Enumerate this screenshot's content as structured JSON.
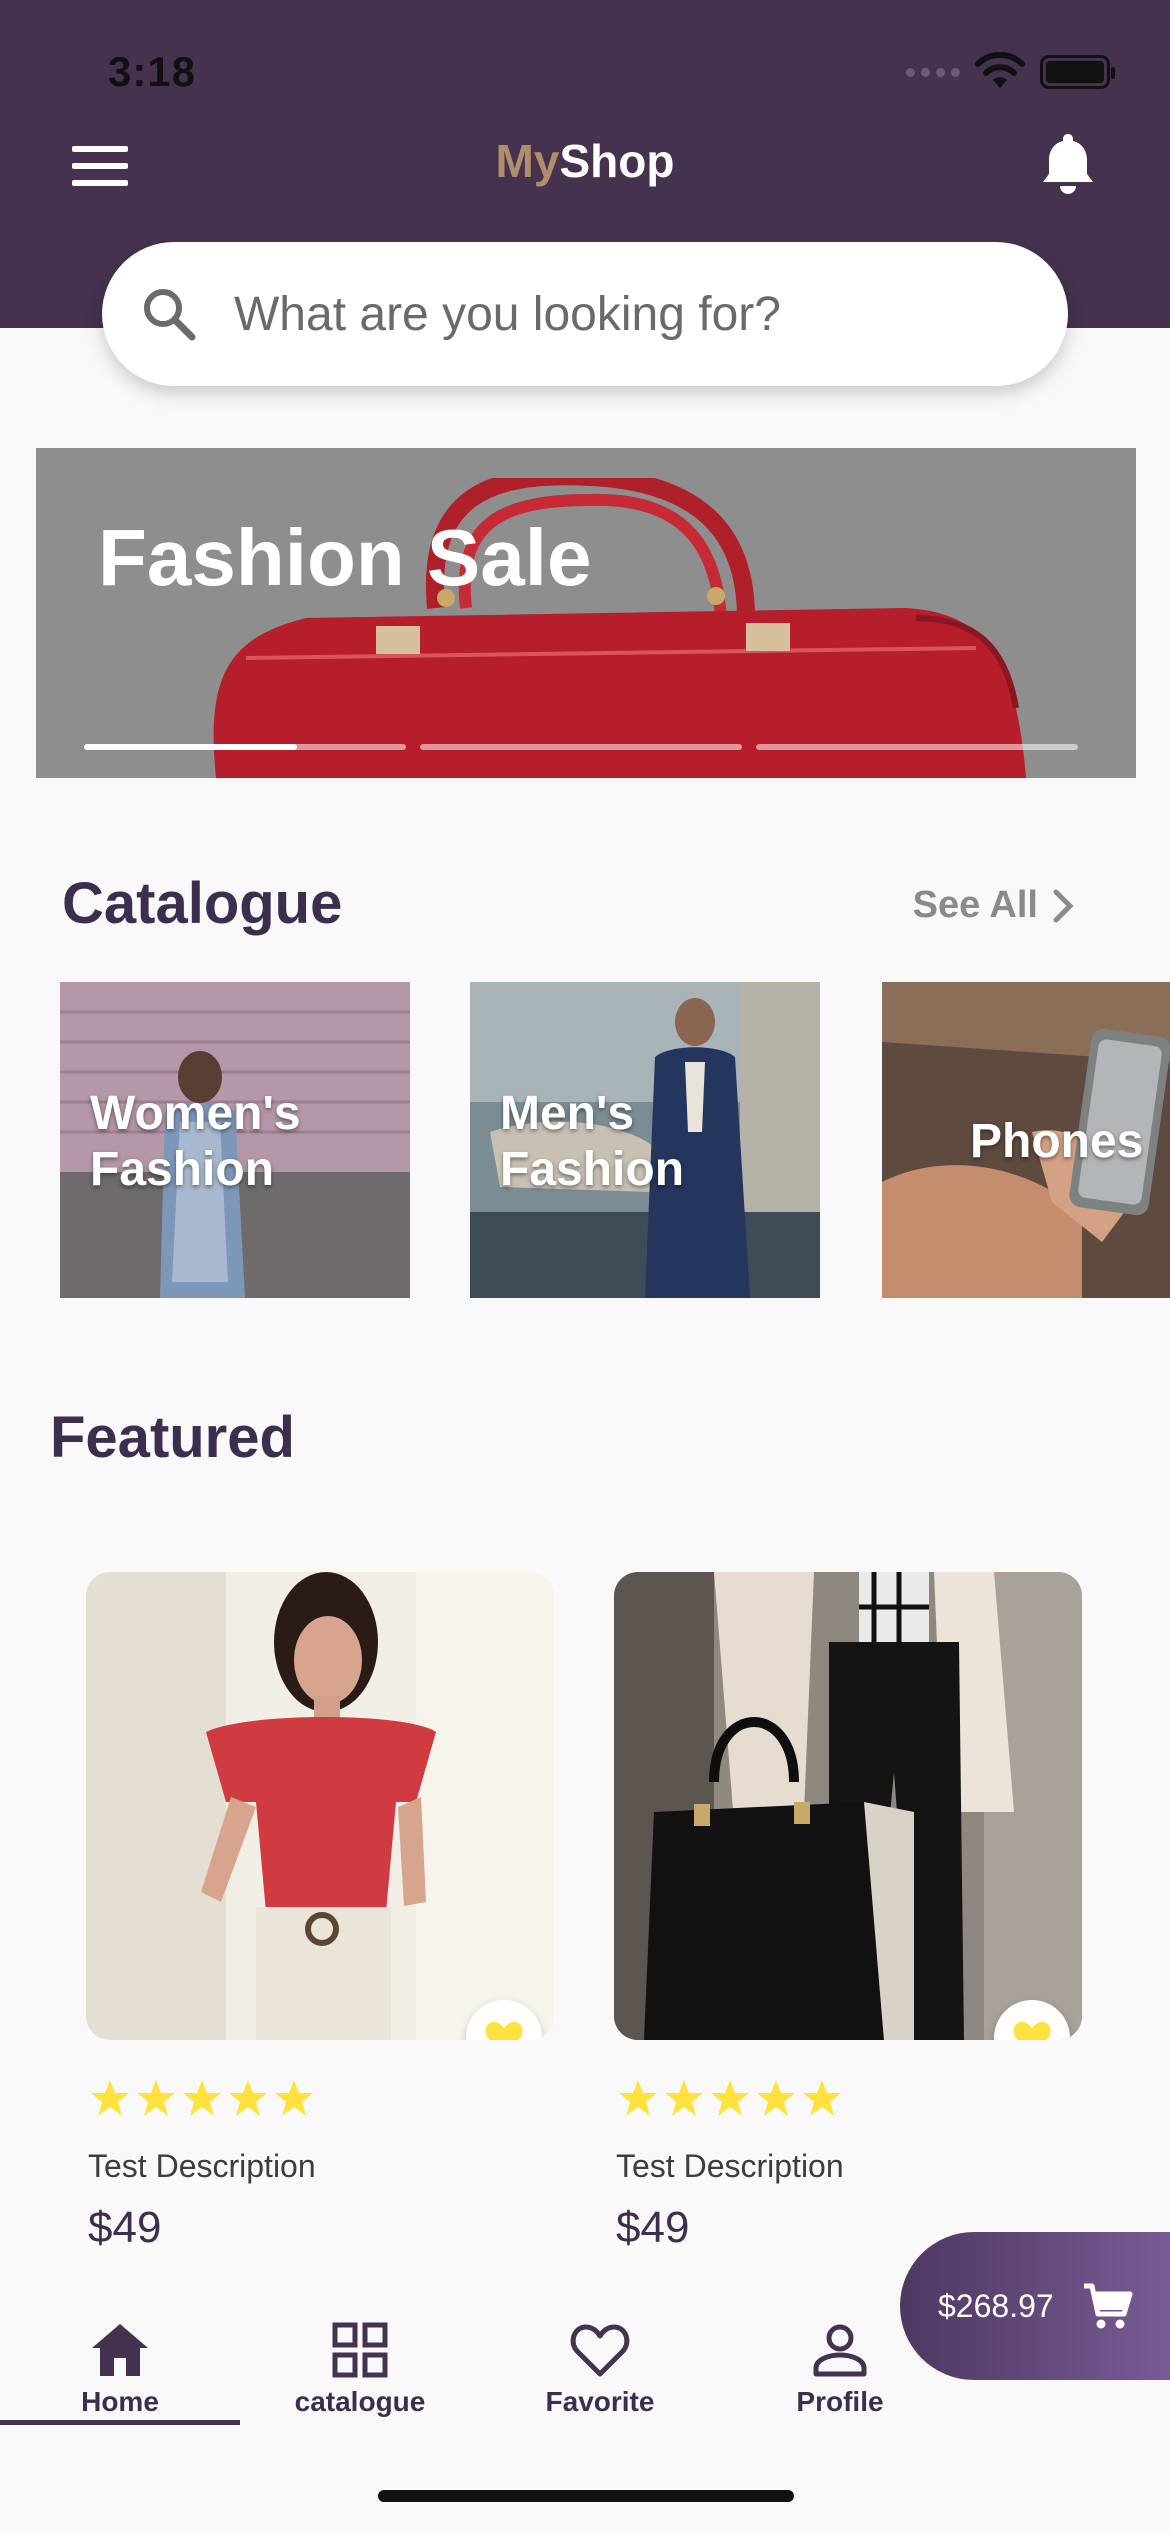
{
  "status_bar": {
    "time": "3:18"
  },
  "header": {
    "brand_part1": "My",
    "brand_part2": "Shop",
    "brand_colors": {
      "my": "#b08d6b",
      "shop": "#ffffff"
    },
    "background": "#44324f",
    "menu_icon": "hamburger-menu-icon",
    "notification_icon": "bell-icon"
  },
  "search": {
    "placeholder": "What are you looking for?",
    "value": ""
  },
  "banner": {
    "title": "Fashion Sale",
    "slides_count": 3,
    "active_slide": 1,
    "active_progress": 0.66
  },
  "catalogue": {
    "title": "Catalogue",
    "see_all": "See All",
    "items": [
      {
        "line1": "Women's",
        "line2": "Fashion"
      },
      {
        "line1": "Men's",
        "line2": "Fashion"
      },
      {
        "line1": "Phones",
        "line2": ""
      }
    ]
  },
  "featured": {
    "title": "Featured",
    "products": [
      {
        "description": "Test Description",
        "price": "$49",
        "rating": 5,
        "favorite": true
      },
      {
        "description": "Test Description",
        "price": "$49",
        "rating": 5,
        "favorite": true
      }
    ]
  },
  "cart": {
    "total": "$268.97",
    "icon": "shopping-cart-icon"
  },
  "tabs": [
    {
      "label": "Home",
      "icon": "home-icon",
      "active": true
    },
    {
      "label": "catalogue",
      "icon": "grid-icon",
      "active": false
    },
    {
      "label": "Favorite",
      "icon": "heart-icon",
      "active": false
    },
    {
      "label": "Profile",
      "icon": "person-icon",
      "active": false
    }
  ],
  "colors": {
    "accent": "#44324f",
    "star": "#ffe23d",
    "heart": "#ffe23d"
  }
}
